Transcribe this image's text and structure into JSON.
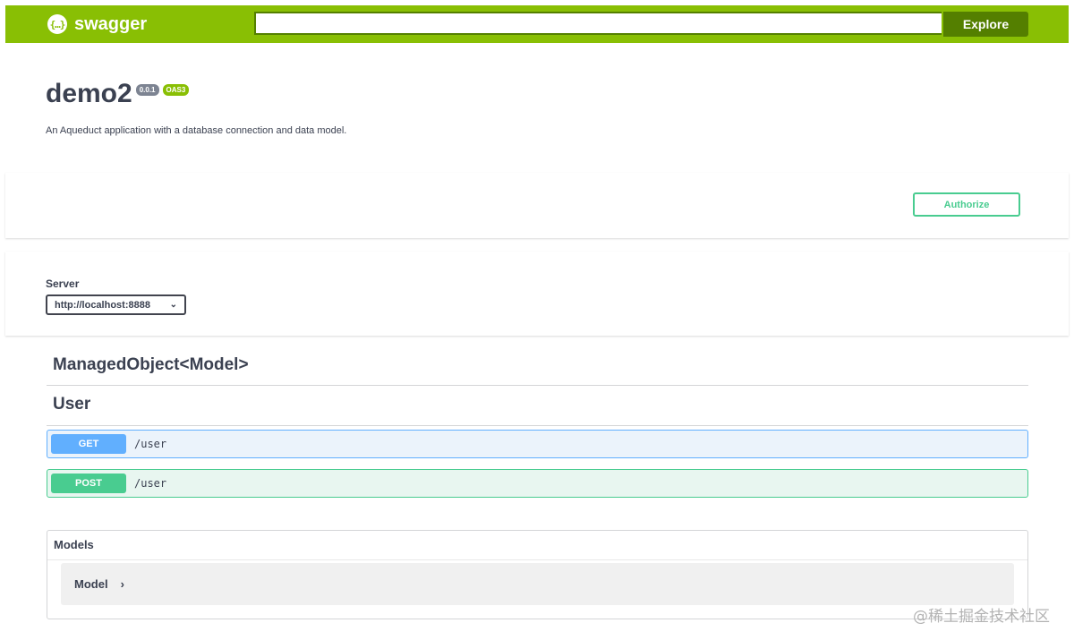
{
  "topbar": {
    "logo_text": "swagger",
    "logo_glyph": "{…}",
    "search_value": "",
    "explore_label": "Explore"
  },
  "info": {
    "title": "demo2",
    "version_badge": "0.0.1",
    "oas_badge": "OAS3",
    "description": "An Aqueduct application with a database connection and data model."
  },
  "auth": {
    "authorize_label": "Authorize"
  },
  "servers": {
    "label": "Server",
    "selected": "http://localhost:8888"
  },
  "tags": [
    {
      "name": "ManagedObject<Model>"
    },
    {
      "name": "User"
    }
  ],
  "operations": [
    {
      "method": "GET",
      "path": "/user"
    },
    {
      "method": "POST",
      "path": "/user"
    }
  ],
  "models": {
    "title": "Models",
    "items": [
      {
        "name": "Model"
      }
    ]
  },
  "watermark": "@稀土掘金技术社区",
  "colors": {
    "topbar": "#89bf04",
    "explore": "#547f00",
    "get": "#61affe",
    "post": "#49cc90",
    "text": "#3b4151"
  }
}
